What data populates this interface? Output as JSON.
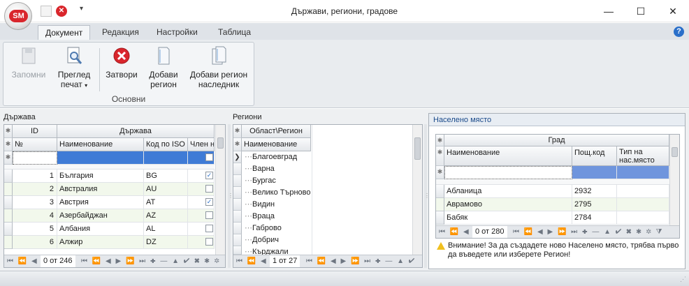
{
  "app": {
    "logo": "SM",
    "title": "Държави, региони, градове"
  },
  "tabs": [
    "Документ",
    "Редакция",
    "Настройки",
    "Таблица"
  ],
  "ribbon": {
    "group_label": "Основни",
    "buttons": {
      "save": "Запомни",
      "preview_line1": "Преглед",
      "preview_line2": "печат",
      "close": "Затвори",
      "add_region_line1": "Добави",
      "add_region_line2": "регион",
      "add_child_line1": "Добави регион",
      "add_child_line2": "наследник"
    }
  },
  "country_panel": {
    "title": "Държава",
    "band_id": "ID",
    "band_country": "Държава",
    "columns": [
      "№",
      "Наименование",
      "Код по ISO",
      "Член на"
    ],
    "rows": [
      {
        "num": "1",
        "name": "България",
        "iso": "BG",
        "member": true
      },
      {
        "num": "2",
        "name": "Австралия",
        "iso": "AU",
        "member": false
      },
      {
        "num": "3",
        "name": "Австрия",
        "iso": "AT",
        "member": true
      },
      {
        "num": "4",
        "name": "Азербайджан",
        "iso": "AZ",
        "member": false
      },
      {
        "num": "5",
        "name": "Албания",
        "iso": "AL",
        "member": false
      },
      {
        "num": "6",
        "name": "Алжир",
        "iso": "DZ",
        "member": false
      }
    ],
    "position": "0 от 246"
  },
  "region_panel": {
    "title": "Региони",
    "band": "Област\\Регион",
    "column": "Наименование",
    "items": [
      "Благоевград",
      "Варна",
      "Бургас",
      "Велико Търново",
      "Видин",
      "Враца",
      "Габрово",
      "Добрич",
      "Кърджали"
    ],
    "position": "1 от 27"
  },
  "place_panel": {
    "title": "Населено място",
    "band": "Град",
    "columns": [
      "Наименование",
      "Пощ.код",
      "Тип на нас.място"
    ],
    "rows": [
      {
        "name": "Абланица",
        "code": "2932"
      },
      {
        "name": "Аврамово",
        "code": "2795"
      },
      {
        "name": "Бабяк",
        "code": "2784"
      }
    ],
    "position": "0 от 280",
    "warning": "Внимание! За да създадете ново Населено място, трябва първо да въведете или изберете Регион!"
  },
  "navigator": {
    "controls": "⏮ ⏪ ◀ ▶ ⏩ ⏭ ✚ — ▲ ✔ ✖ ✱ ✲ ⧩"
  }
}
